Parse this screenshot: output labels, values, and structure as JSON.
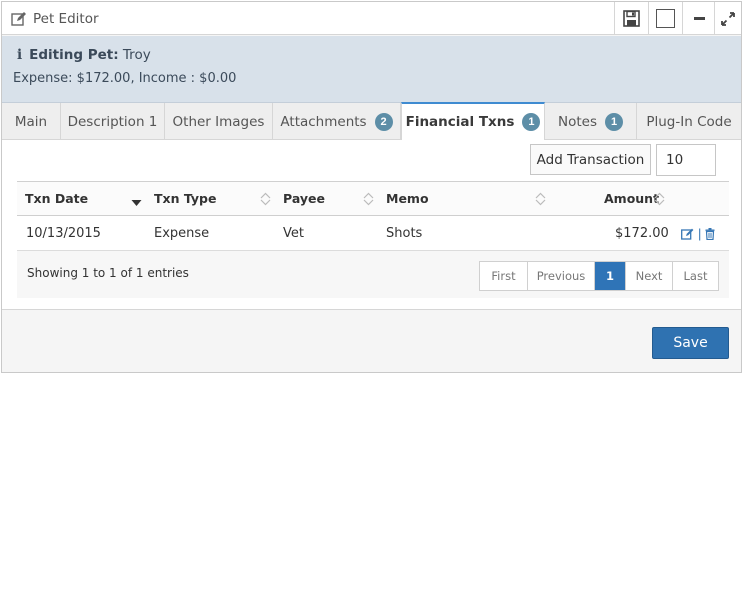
{
  "window": {
    "title": "Pet Editor",
    "title_icon": "edit-icon",
    "controls": [
      "save-icon",
      "maximize-icon",
      "minimize-icon",
      "fullscreen-icon"
    ]
  },
  "info": {
    "label": "Editing Pet:",
    "pet_name": "Troy",
    "summary": "Expense: $172.00, Income : $0.00"
  },
  "tabs": [
    {
      "label": "Main",
      "badge": null
    },
    {
      "label": "Description 1",
      "badge": null
    },
    {
      "label": "Other Images",
      "badge": null
    },
    {
      "label": "Attachments",
      "badge": "2"
    },
    {
      "label": "Financial Txns",
      "badge": "1",
      "active": true
    },
    {
      "label": "Notes",
      "badge": "1"
    },
    {
      "label": "Plug-In Code",
      "badge": null
    }
  ],
  "toolbar": {
    "add_label": "Add Transaction",
    "page_size": "10"
  },
  "table": {
    "columns": [
      "Txn Date",
      "Txn Type",
      "Payee",
      "Memo",
      "Amount"
    ],
    "rows": [
      {
        "date": "10/13/2015",
        "type": "Expense",
        "payee": "Vet",
        "memo": "Shots",
        "amount": "$172.00",
        "separator": "|"
      }
    ],
    "info": "Showing 1 to 1 of 1 entries"
  },
  "pager": {
    "first": "First",
    "previous": "Previous",
    "current": "1",
    "next": "Next",
    "last": "Last"
  },
  "actions": {
    "save_label": "Save"
  },
  "colors": {
    "accent": "#2f74b7",
    "info_bg": "#d8e1ea",
    "badge": "#5d8ea7"
  }
}
